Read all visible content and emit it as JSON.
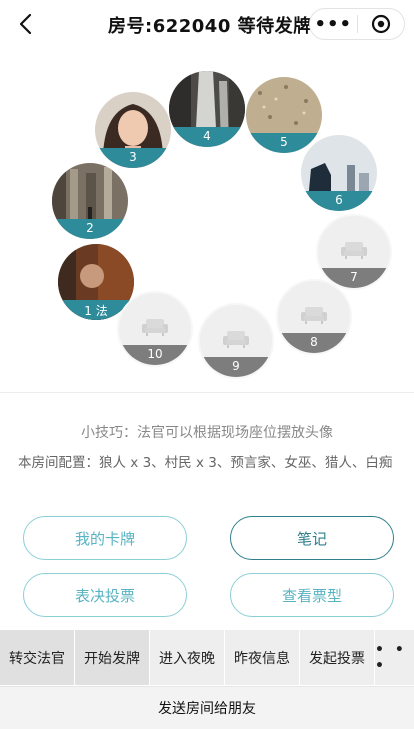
{
  "header": {
    "title": "房号:622040 等待发牌",
    "more_glyph": "•••"
  },
  "seats": [
    {
      "num": "1 法",
      "filled": true
    },
    {
      "num": "2",
      "filled": true
    },
    {
      "num": "3",
      "filled": true
    },
    {
      "num": "4",
      "filled": true
    },
    {
      "num": "5",
      "filled": true
    },
    {
      "num": "6",
      "filled": true
    },
    {
      "num": "7",
      "filled": false
    },
    {
      "num": "8",
      "filled": false
    },
    {
      "num": "9",
      "filled": false
    },
    {
      "num": "10",
      "filled": false
    }
  ],
  "tip": "小技巧：法官可以根据现场座位摆放头像",
  "config": "本房间配置：狼人 x 3、村民 x 3、预言家、女巫、猎人、白痴",
  "buttons": {
    "my_card": "我的卡牌",
    "notes": "笔记",
    "vote": "表决投票",
    "view_votes": "查看票型"
  },
  "toolbar": {
    "transfer_judge": "转交法官",
    "start_deal": "开始发牌",
    "enter_night": "进入夜晚",
    "last_night": "昨夜信息",
    "start_vote": "发起投票",
    "more": "• • •"
  },
  "share": "发送房间给朋友",
  "colors": {
    "accent": "#2e8b9a",
    "empty_band": "#7d7d7d",
    "button_border": "#8ccfd6"
  }
}
